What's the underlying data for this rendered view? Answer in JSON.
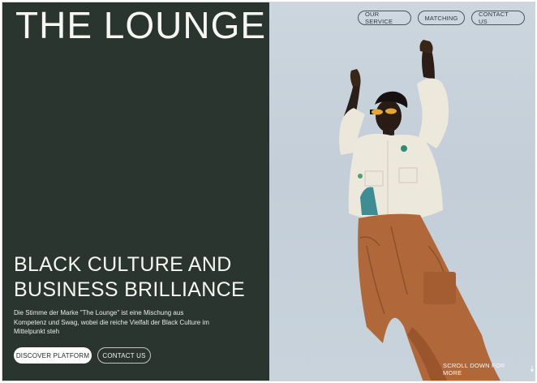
{
  "brand": {
    "name": "THE LOUNGE"
  },
  "hero": {
    "headline_line1": "BLACK CULTURE AND",
    "headline_line2": "BUSINESS BRILLIANCE",
    "description": "Die Stimme der Marke \"The Lounge\" ist eine Mischung aus Kompetenz und Swag, wobei die reiche Vielfalt der Black Culture im Mittelpunkt steh",
    "primary_cta": "DISCOVER PLATFORM",
    "secondary_cta": "CONTACT US"
  },
  "nav": {
    "items": [
      "OUR SERVICE",
      "MATCHING",
      "CONTACT US"
    ]
  },
  "scroll_hint": {
    "label": "SCROLL DOWN FOR MORE",
    "icon": "arrow-down-icon"
  },
  "colors": {
    "left_panel": "#2b3530",
    "sky": "#c8d3dc",
    "jacket": "#ece8dc",
    "pants": "#b0683a"
  }
}
